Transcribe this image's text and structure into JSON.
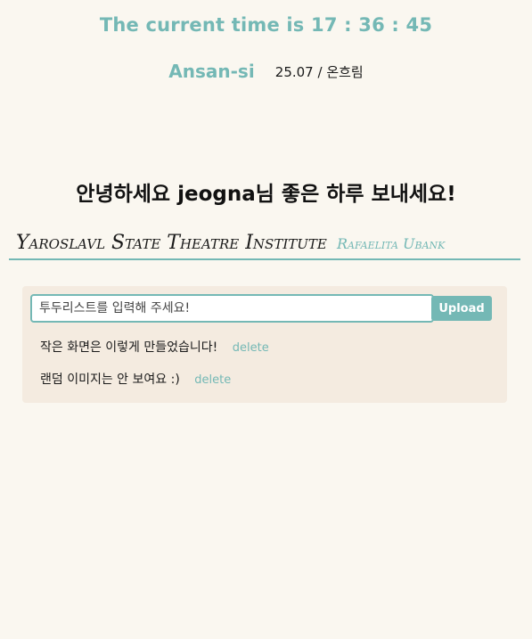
{
  "clock": {
    "text": "The current time is 17 : 36 : 45"
  },
  "weather": {
    "city": "Ansan-si",
    "temp": "25.07 / 온흐림"
  },
  "greeting": {
    "text": "안녕하세요 jeogna님 좋은 하루 보내세요!"
  },
  "quote": {
    "text": "Yaroslavl State Theatre Institute",
    "author": "Rafaelita Ubank"
  },
  "todo": {
    "placeholder": "투두리스트를 입력해 주세요!",
    "upload_label": "Upload",
    "items": [
      {
        "text": "작은 화면은 이렇게 만들었습니다!",
        "delete_label": "delete"
      },
      {
        "text": "랜덤 이미지는 안 보여요 :)",
        "delete_label": "delete"
      }
    ]
  },
  "colors": {
    "accent": "#74b8b5",
    "background": "#faf7f0",
    "panel": "#f4ebe0"
  }
}
